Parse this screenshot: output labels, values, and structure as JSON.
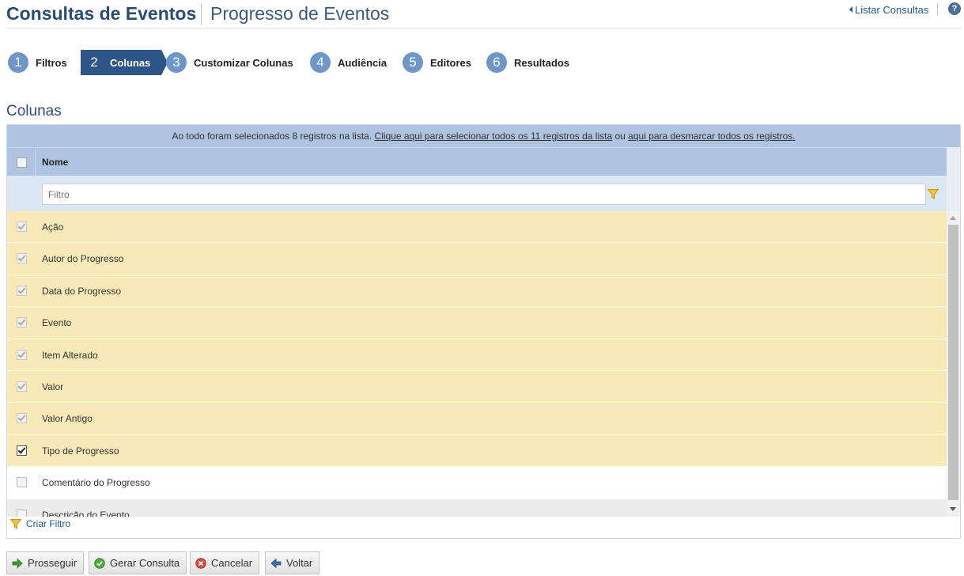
{
  "header": {
    "title": "Consultas de Eventos",
    "subtitle": "Progresso de Eventos",
    "list_link": "Listar Consultas",
    "help": "?"
  },
  "steps": [
    {
      "num": "1",
      "label": "Filtros"
    },
    {
      "num": "2",
      "label": "Colunas"
    },
    {
      "num": "3",
      "label": "Customizar Colunas"
    },
    {
      "num": "4",
      "label": "Audiência"
    },
    {
      "num": "5",
      "label": "Editores"
    },
    {
      "num": "6",
      "label": "Resultados"
    }
  ],
  "section_title": "Colunas",
  "info": {
    "text1": "Ao todo foram selecionados 8 registros na lista. ",
    "link1": "Clique aqui para selecionar todos os 11 registros da lista",
    "text2": " ou ",
    "link2": "aqui para desmarcar todos os registros."
  },
  "table": {
    "column_header": "Nome",
    "filter_placeholder": "Filtro",
    "rows": [
      {
        "label": "Ação",
        "checked": true,
        "disabled": true
      },
      {
        "label": "Autor do Progresso",
        "checked": true,
        "disabled": true
      },
      {
        "label": "Data do Progresso",
        "checked": true,
        "disabled": true
      },
      {
        "label": "Evento",
        "checked": true,
        "disabled": true
      },
      {
        "label": "Item Alterado",
        "checked": true,
        "disabled": true
      },
      {
        "label": "Valor",
        "checked": true,
        "disabled": true
      },
      {
        "label": "Valor Antigo",
        "checked": true,
        "disabled": true
      },
      {
        "label": "Tipo de Progresso",
        "checked": true,
        "disabled": false
      },
      {
        "label": "Comentário do Progresso",
        "checked": false,
        "disabled": false
      },
      {
        "label": "Descrição do Evento",
        "checked": false,
        "disabled": false
      }
    ]
  },
  "footer": {
    "create_filter": "Criar Filtro"
  },
  "buttons": {
    "proceed": "Prosseguir",
    "generate": "Gerar Consulta",
    "cancel": "Cancelar",
    "back": "Voltar"
  },
  "colors": {
    "brand": "#2a4d78",
    "active_step": "#2d5587",
    "step_circle": "#6d96c9",
    "header_bar": "#aec4e0",
    "selected_row": "#f8eab8"
  }
}
